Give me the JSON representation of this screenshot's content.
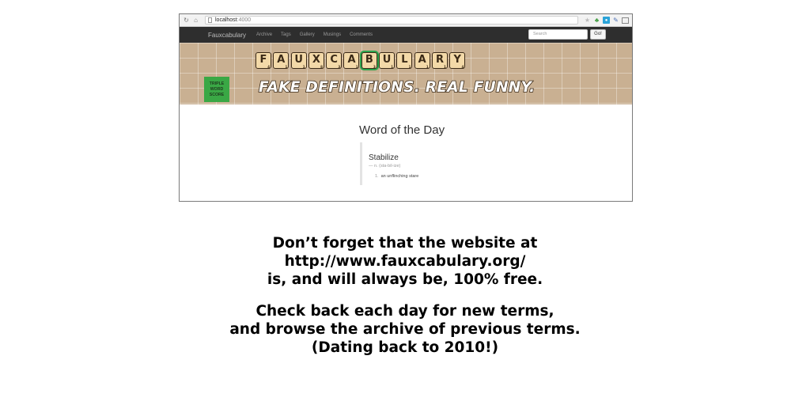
{
  "browser": {
    "url_host": "localhost",
    "url_port": ":4000"
  },
  "navbar": {
    "brand": "Fauxcabulary",
    "links": [
      "Archive",
      "Tags",
      "Gallery",
      "Musings",
      "Comments"
    ],
    "search_placeholder": "Search",
    "go_label": "Go!"
  },
  "banner": {
    "tiles": [
      {
        "letter": "F",
        "points": "4"
      },
      {
        "letter": "A",
        "points": "1"
      },
      {
        "letter": "U",
        "points": "1"
      },
      {
        "letter": "X",
        "points": "8"
      },
      {
        "letter": "C",
        "points": "3"
      },
      {
        "letter": "A",
        "points": "1"
      },
      {
        "letter": "B",
        "points": "3"
      },
      {
        "letter": "U",
        "points": "1"
      },
      {
        "letter": "L",
        "points": "1"
      },
      {
        "letter": "A",
        "points": "1"
      },
      {
        "letter": "R",
        "points": "1"
      },
      {
        "letter": "Y",
        "points": "4"
      }
    ],
    "tagline": "FAKE DEFINITIONS. REAL FUNNY.",
    "triple_line1": "TRIPLE",
    "triple_line2": "WORD",
    "triple_line3": "SCORE"
  },
  "main": {
    "heading": "Word of the Day",
    "word": "Stabilize",
    "pronunciation": "— n. (sta-bil-ize)",
    "def_number": "1.",
    "definition": "an unflinching stare"
  },
  "caption": {
    "line1": "Don’t forget that the website at",
    "line2": "http://www.fauxcabulary.org/",
    "line3": "is, and will always be, 100% free.",
    "line4": "Check back each day for new terms,",
    "line5": "and browse the archive of previous terms.",
    "line6": "(Dating back to 2010!)"
  }
}
